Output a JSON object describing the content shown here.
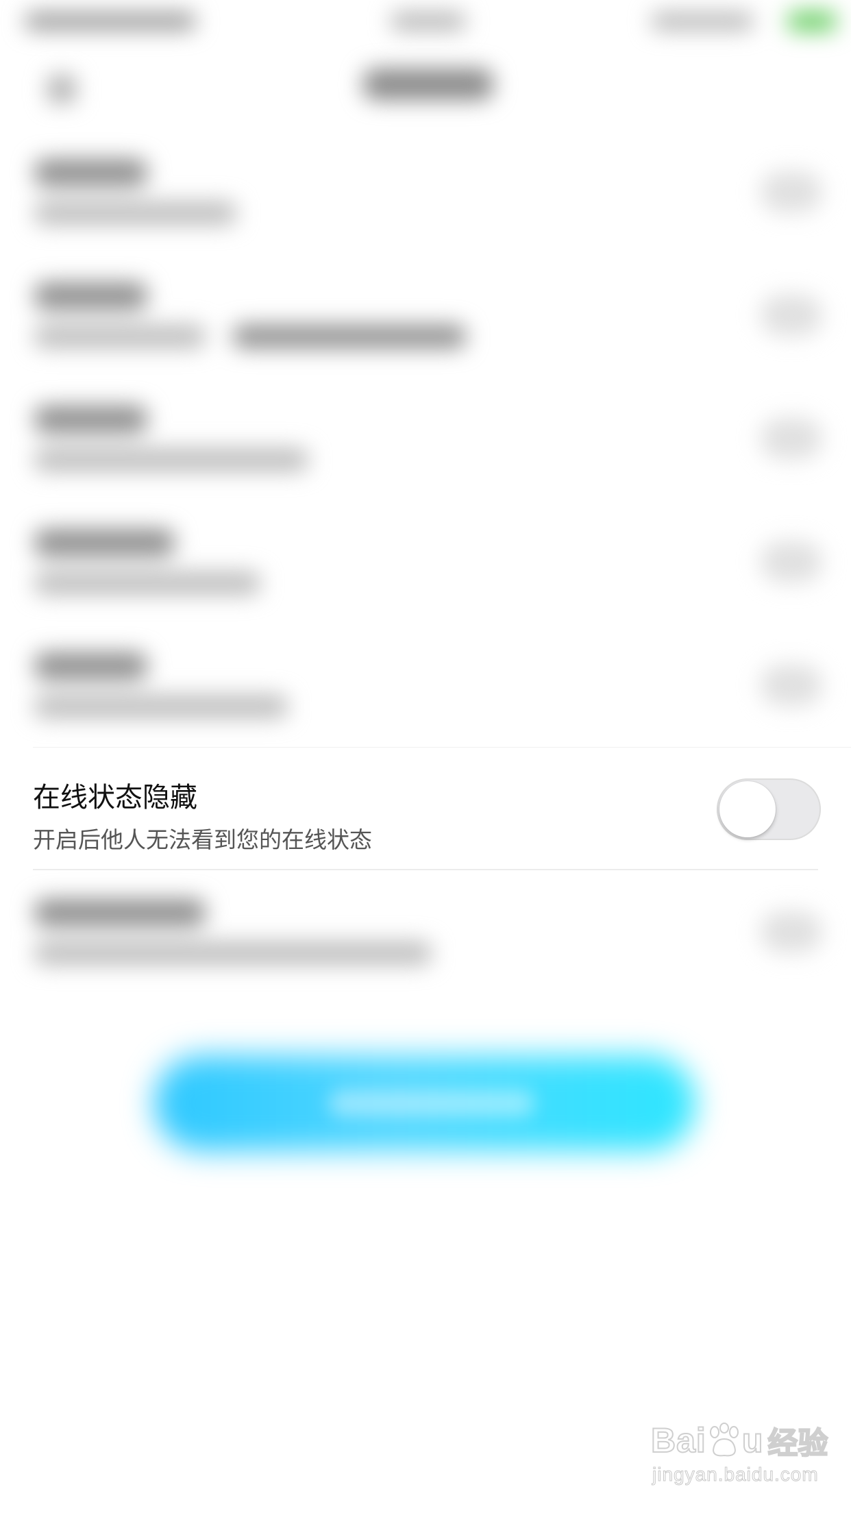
{
  "setting_row": {
    "title": "在线状态隐藏",
    "subtitle": "开启后他人无法看到您的在线状态",
    "toggle_on": false
  },
  "watermark": {
    "logo_left": "Bai",
    "logo_right": "u",
    "logo_cn": "经验",
    "url": "jingyan.baidu.com"
  },
  "colors": {
    "primary_button": "#2ec8ff",
    "toggle_off_track": "#e9e9eb",
    "status_battery": "#6fd06a"
  }
}
